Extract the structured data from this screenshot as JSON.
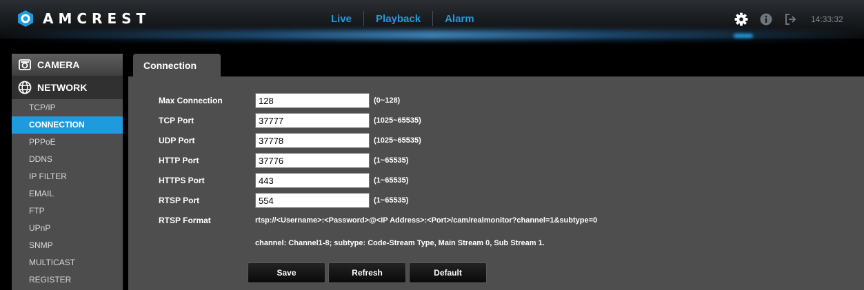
{
  "header": {
    "brand": "AMCREST",
    "nav": [
      "Live",
      "Playback",
      "Alarm"
    ],
    "icons": [
      "settings-gear-icon",
      "info-icon",
      "logout-icon"
    ],
    "clock": "14:33:32",
    "accent_color": "#1e9bde"
  },
  "sidebar": {
    "categories": [
      {
        "label": "CAMERA",
        "icon": "camera-icon"
      },
      {
        "label": "NETWORK",
        "icon": "network-globe-icon"
      }
    ],
    "items": [
      "TCP/IP",
      "CONNECTION",
      "PPPoE",
      "DDNS",
      "IP FILTER",
      "EMAIL",
      "FTP",
      "UPnP",
      "SNMP",
      "MULTICAST",
      "REGISTER"
    ],
    "active_item": "CONNECTION"
  },
  "tab": {
    "label": "Connection"
  },
  "form": {
    "max_connection": {
      "label": "Max Connection",
      "value": "128",
      "range": "(0~128)"
    },
    "tcp_port": {
      "label": "TCP Port",
      "value": "37777",
      "range": "(1025~65535)"
    },
    "udp_port": {
      "label": "UDP Port",
      "value": "37778",
      "range": "(1025~65535)"
    },
    "http_port": {
      "label": "HTTP Port",
      "value": "37776",
      "range": "(1~65535)"
    },
    "https_port": {
      "label": "HTTPS Port",
      "value": "443",
      "range": "(1~65535)"
    },
    "rtsp_port": {
      "label": "RTSP Port",
      "value": "554",
      "range": "(1~65535)"
    },
    "rtsp_format": {
      "label": "RTSP Format",
      "value": "rtsp://<Username>:<Password>@<IP Address>:<Port>/cam/realmonitor?channel=1&subtype=0",
      "note": "channel: Channel1-8; subtype: Code-Stream Type, Main Stream 0, Sub Stream 1."
    }
  },
  "buttons": {
    "save": "Save",
    "refresh": "Refresh",
    "default": "Default"
  }
}
